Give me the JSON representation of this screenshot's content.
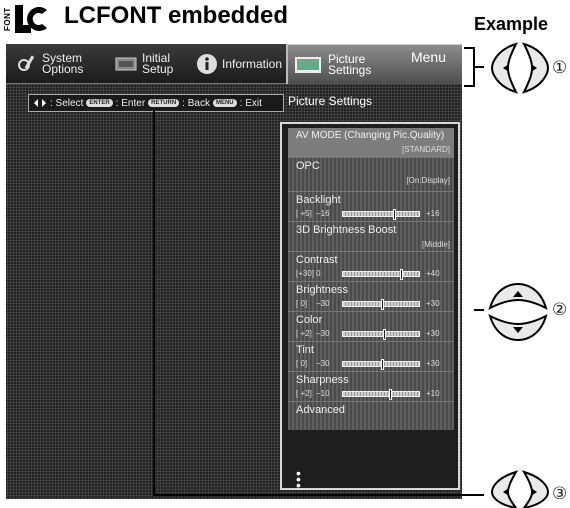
{
  "header": {
    "font_badge": "FONT",
    "title": "LCFONT embedded",
    "example": "Example"
  },
  "menubar": {
    "tabs": [
      {
        "label": "System Options",
        "icon": "wrench-gear-icon"
      },
      {
        "label": "Initial Setup",
        "icon": "setup-icon"
      },
      {
        "label": "Information",
        "icon": "info-icon"
      },
      {
        "label": "Picture Settings",
        "icon": "picture-icon",
        "selected": true
      }
    ],
    "menu_label": "Menu"
  },
  "hint": {
    "select": ": Select",
    "enter_key": "ENTER",
    "enter": ": Enter",
    "return_key": "RETURN",
    "back": ": Back",
    "menu_key": "MENU",
    "exit": ": Exit"
  },
  "subtitle": "Picture Settings",
  "settings": {
    "avmode": {
      "label": "AV MODE (Changing Pic.Quality)",
      "value": "[STANDARD]"
    },
    "opc": {
      "label": "OPC",
      "value": "[On:Display]"
    },
    "backlight": {
      "label": "Backlight",
      "current": "[ +5]",
      "min": "−16",
      "max": "+16",
      "level": 0.66
    },
    "brightboost": {
      "label": "3D Brightness Boost",
      "value": "[Middle]"
    },
    "contrast": {
      "label": "Contrast",
      "current": "[+30]",
      "min": "0",
      "max": "+40",
      "level": 0.75
    },
    "brightness": {
      "label": "Brightness",
      "current": "[ 0]",
      "min": "−30",
      "max": "+30",
      "level": 0.5
    },
    "color": {
      "label": "Color",
      "current": "[ +2]",
      "min": "−30",
      "max": "+30",
      "level": 0.53
    },
    "tint": {
      "label": "Tint",
      "current": "[ 0]",
      "min": "−30",
      "max": "+30",
      "level": 0.5
    },
    "sharpness": {
      "label": "Sharpness",
      "current": "[ +2]",
      "min": "−10",
      "max": "+10",
      "level": 0.6
    },
    "advanced": {
      "label": "Advanced"
    }
  },
  "annotations": {
    "n1": "①",
    "n2": "②",
    "n3": "③"
  }
}
